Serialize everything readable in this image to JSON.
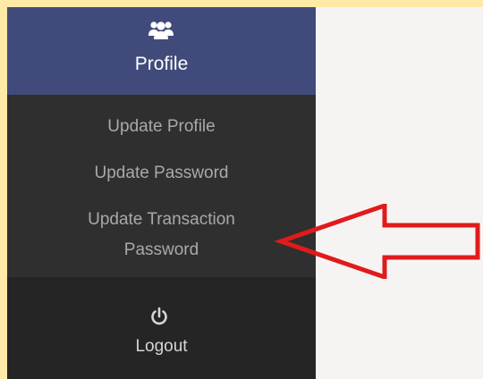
{
  "profile": {
    "icon": "users-icon",
    "label": "Profile"
  },
  "submenu": {
    "items": [
      {
        "label": "Update Profile"
      },
      {
        "label": "Update Password"
      },
      {
        "label_line1": "Update Transaction",
        "label_line2": "Password"
      }
    ]
  },
  "logout": {
    "icon": "power-icon",
    "label": "Logout"
  },
  "annotation": {
    "icon": "red-arrow-icon",
    "color": "#e01b1b"
  },
  "colors": {
    "border": "#fee9a6",
    "profile_bg": "#414b7b",
    "sidebar_bg": "#252525",
    "submenu_bg": "#2f2f2f",
    "content_bg": "#f6f4f3"
  }
}
